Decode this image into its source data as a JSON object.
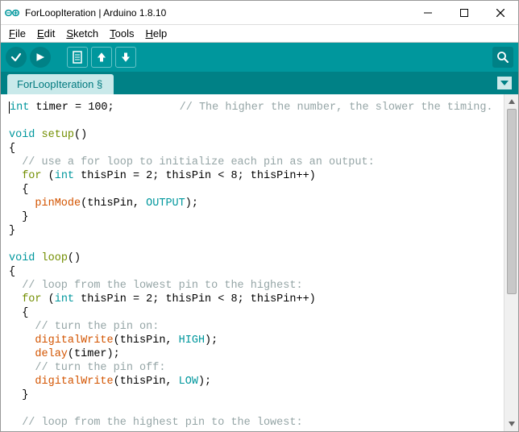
{
  "title": "ForLoopIteration | Arduino 1.8.10",
  "menu": {
    "file": "File",
    "edit": "Edit",
    "sketch": "Sketch",
    "tools": "Tools",
    "help": "Help"
  },
  "tab": {
    "name": "ForLoopIteration §"
  },
  "code": {
    "l1a": "int",
    "l1b": " timer = 100;          ",
    "l1c": "// The higher the number, the slower the timing.",
    "l3a": "void",
    "l3b": "setup",
    "l3c": "()",
    "l4": "{",
    "l5": "  // use a for loop to initialize each pin as an output:",
    "l6a": "  ",
    "l6b": "for",
    "l6c": " (",
    "l6d": "int",
    "l6e": " thisPin = 2; thisPin < 8; thisPin++)",
    "l7": "  {",
    "l8a": "    ",
    "l8b": "pinMode",
    "l8c": "(thisPin, ",
    "l8d": "OUTPUT",
    "l8e": ");",
    "l9": "  }",
    "l10": "}",
    "l12a": "void",
    "l12b": "loop",
    "l12c": "()",
    "l13": "{",
    "l14": "  // loop from the lowest pin to the highest:",
    "l15a": "  ",
    "l15b": "for",
    "l15c": " (",
    "l15d": "int",
    "l15e": " thisPin = 2; thisPin < 8; thisPin++)",
    "l16": "  {",
    "l17": "    // turn the pin on:",
    "l18a": "    ",
    "l18b": "digitalWrite",
    "l18c": "(thisPin, ",
    "l18d": "HIGH",
    "l18e": ");",
    "l19a": "    ",
    "l19b": "delay",
    "l19c": "(timer);",
    "l20": "    // turn the pin off:",
    "l21a": "    ",
    "l21b": "digitalWrite",
    "l21c": "(thisPin, ",
    "l21d": "LOW",
    "l21e": ");",
    "l22": "  }",
    "l24": "  // loop from the highest pin to the lowest:"
  }
}
